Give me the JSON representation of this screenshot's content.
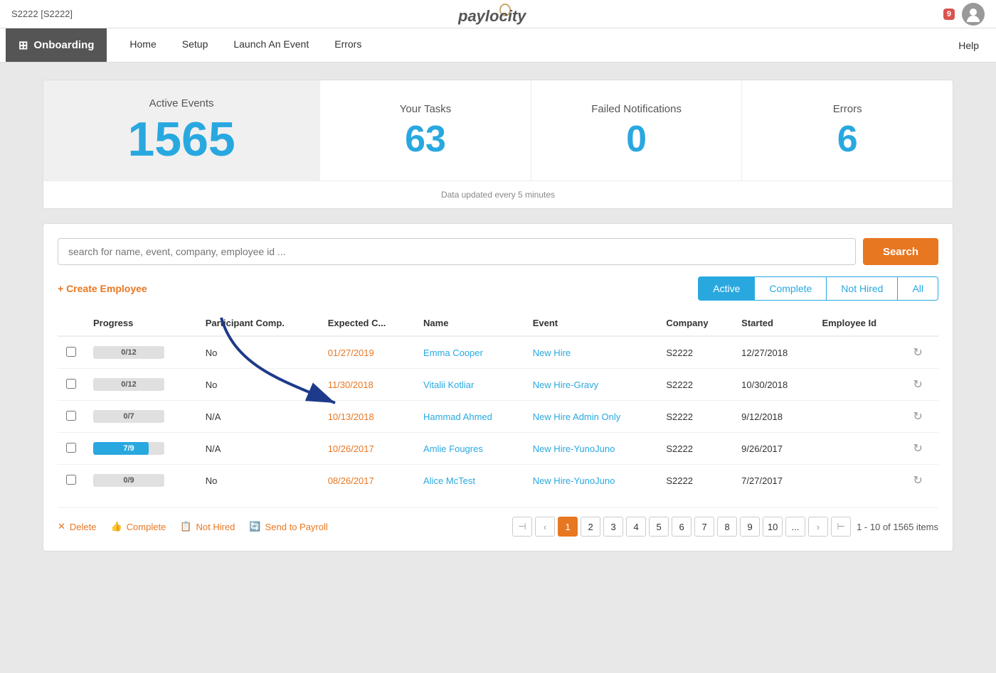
{
  "topbar": {
    "company": "S2222 [S2222]",
    "logo": "paylocity",
    "notif_count": "9",
    "help_label": "Help"
  },
  "nav": {
    "module": "Onboarding",
    "items": [
      "Home",
      "Setup",
      "Launch An Event",
      "Errors"
    ]
  },
  "stats": {
    "active_events_label": "Active Events",
    "active_events_value": "1565",
    "your_tasks_label": "Your Tasks",
    "your_tasks_value": "63",
    "failed_notifications_label": "Failed Notifications",
    "failed_notifications_value": "0",
    "errors_label": "Errors",
    "errors_value": "6",
    "data_note": "Data updated every 5 minutes"
  },
  "search": {
    "placeholder": "search for name, event, company, employee id ...",
    "button_label": "Search"
  },
  "table": {
    "create_employee": "+ Create Employee",
    "filter_tabs": [
      "Active",
      "Complete",
      "Not Hired",
      "All"
    ],
    "active_filter": 0,
    "columns": [
      "",
      "Progress",
      "Participant Comp.",
      "Expected C...",
      "Name",
      "Event",
      "Company",
      "Started",
      "Employee Id",
      ""
    ],
    "rows": [
      {
        "progress_text": "0/12",
        "progress_pct": 0,
        "participant_comp": "No",
        "expected_date": "01/27/2019",
        "name": "Emma Cooper",
        "event": "New Hire",
        "company": "S2222",
        "started": "12/27/2018",
        "employee_id": ""
      },
      {
        "progress_text": "0/12",
        "progress_pct": 0,
        "participant_comp": "No",
        "expected_date": "11/30/2018",
        "name": "Vitalii Kotliar",
        "event": "New Hire-Gravy",
        "company": "S2222",
        "started": "10/30/2018",
        "employee_id": ""
      },
      {
        "progress_text": "0/7",
        "progress_pct": 0,
        "participant_comp": "N/A",
        "expected_date": "10/13/2018",
        "name": "Hammad Ahmed",
        "event": "New Hire Admin Only",
        "company": "S2222",
        "started": "9/12/2018",
        "employee_id": ""
      },
      {
        "progress_text": "7/9",
        "progress_pct": 78,
        "participant_comp": "N/A",
        "expected_date": "10/26/2017",
        "name": "Amlie Fougres",
        "event": "New Hire-YunoJuno",
        "company": "S2222",
        "started": "9/26/2017",
        "employee_id": ""
      },
      {
        "progress_text": "0/9",
        "progress_pct": 0,
        "participant_comp": "No",
        "expected_date": "08/26/2017",
        "name": "Alice McTest",
        "event": "New Hire-YunoJuno",
        "company": "S2222",
        "started": "7/27/2017",
        "employee_id": ""
      }
    ],
    "bulk_actions": {
      "delete": "Delete",
      "complete": "Complete",
      "not_hired": "Not Hired",
      "send_to_payroll": "Send to Payroll"
    },
    "pagination": {
      "pages": [
        "1",
        "2",
        "3",
        "4",
        "5",
        "6",
        "7",
        "8",
        "9",
        "10",
        "..."
      ],
      "current": "1",
      "total_info": "1 - 10 of 1565 items"
    }
  }
}
